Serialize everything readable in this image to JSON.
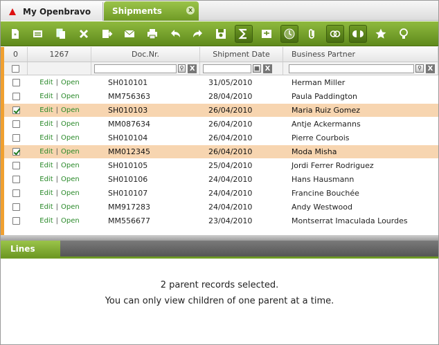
{
  "tabs": [
    {
      "label": "My Openbravo"
    },
    {
      "label": "Shipments",
      "close": "x"
    }
  ],
  "toolbar": [
    {
      "icon": "new-document-icon"
    },
    {
      "icon": "new-row-icon"
    },
    {
      "icon": "copy-icon"
    },
    {
      "icon": "delete-icon"
    },
    {
      "icon": "export-icon"
    },
    {
      "icon": "email-icon"
    },
    {
      "icon": "print-icon"
    },
    {
      "icon": "undo-icon"
    },
    {
      "icon": "redo-icon"
    },
    {
      "icon": "save-icon"
    },
    {
      "icon": "sum-icon"
    },
    {
      "icon": "collapse-icon"
    },
    {
      "icon": "history-icon"
    },
    {
      "icon": "attachment-icon"
    },
    {
      "icon": "link-icon"
    },
    {
      "icon": "toggle-icon"
    },
    {
      "icon": "favorite-icon"
    },
    {
      "icon": "tips-icon"
    }
  ],
  "grid": {
    "header": {
      "selected_count": "0",
      "total_count": "1267",
      "doc_no": "Doc.Nr.",
      "shipment_date": "Shipment Date",
      "business_partner": "Business Partner"
    },
    "filter": {
      "clear": "X"
    },
    "edit_label": "Edit",
    "open_label": "Open",
    "separator": "|",
    "rows": [
      {
        "doc": "SH010101",
        "date": "31/05/2010",
        "partner": "Herman Miller",
        "selected": false
      },
      {
        "doc": "MM756363",
        "date": "28/04/2010",
        "partner": "Paula Paddington",
        "selected": false
      },
      {
        "doc": "SH010103",
        "date": "26/04/2010",
        "partner": "Maria Ruiz Gomez",
        "selected": true
      },
      {
        "doc": "MM087634",
        "date": "26/04/2010",
        "partner": "Antje Ackermanns",
        "selected": false
      },
      {
        "doc": "SH010104",
        "date": "26/04/2010",
        "partner": "Pierre Courbois",
        "selected": false
      },
      {
        "doc": "MM012345",
        "date": "26/04/2010",
        "partner": "Moda Misha",
        "selected": true
      },
      {
        "doc": "SH010105",
        "date": "25/04/2010",
        "partner": "Jordi Ferrer Rodriguez",
        "selected": false
      },
      {
        "doc": "SH010106",
        "date": "24/04/2010",
        "partner": "Hans Hausmann",
        "selected": false
      },
      {
        "doc": "SH010107",
        "date": "24/04/2010",
        "partner": "Francine Bouchée",
        "selected": false
      },
      {
        "doc": "MM917283",
        "date": "24/04/2010",
        "partner": "Andy Westwood",
        "selected": false
      },
      {
        "doc": "MM556677",
        "date": "23/04/2010",
        "partner": "Montserrat Imaculada Lourdes",
        "selected": false
      }
    ]
  },
  "lines": {
    "tab_label": "Lines",
    "message_line1": "2 parent records selected.",
    "message_line2": "You can only view children of one parent at a time."
  },
  "colors": {
    "accent_green": "#6f9a25",
    "selected_row": "#f7d5b0",
    "left_marker": "#f0a030",
    "link_green": "#2a8a2a"
  }
}
